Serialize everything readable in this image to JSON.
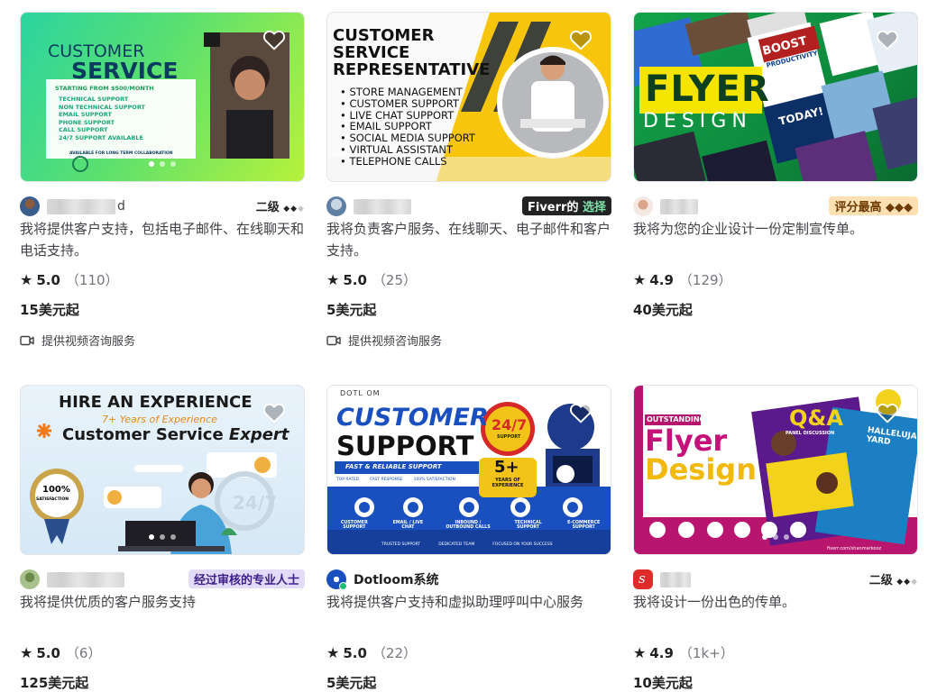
{
  "gigs": [
    {
      "thumb": {
        "title_line1": "CUSTOMER",
        "title_line2": "SERVICE",
        "starting": "STARTING FROM $500/MONTH",
        "items": [
          "TECHNICAL SUPPORT",
          "NON TECHNICAL SUPPORT",
          "EMAIL SUPPORT",
          "PHONE SUPPORT",
          "CALL SUPPORT",
          "24/7 SUPPORT AVAILABLE"
        ],
        "footer": "AVAILABLE FOR LONG TERM COLLABORATION"
      },
      "seller_name_tail": "d",
      "level": "二级",
      "title": "我将提供客户支持，包括电子邮件、在线聊天和电话支持。",
      "score": "5.0",
      "count": "（110）",
      "price": "15美元起",
      "video": "提供视频咨询服务"
    },
    {
      "thumb": {
        "title_line1": "CUSTOMER",
        "title_line2": "SERVICE",
        "title_line3": "REPRESENTATIVE",
        "items": [
          "STORE MANAGEMENT",
          "CUSTOMER SUPPORT",
          "LIVE CHAT SUPPORT",
          "EMAIL SUPPORT",
          "SOCIAL MEDIA SUPPORT",
          "VIRTUAL ASSISTANT",
          "TELEPHONE CALLS"
        ]
      },
      "badge_main": "Fiverr的",
      "badge_accent": "选择",
      "title": "我将负责客户服务、在线聊天、电子邮件和客户支持。",
      "score": "5.0",
      "count": "（25）",
      "price": "5美元起",
      "video": "提供视频咨询服务"
    },
    {
      "thumb": {
        "flyer": "FLYER",
        "design": "DESIGN",
        "boost": "BOOST",
        "productivity": "PRODUCTIVITY",
        "today": "TODAY!"
      },
      "badge": "评分最高 ◆◆◆",
      "title": "我将为您的企业设计一份定制宣传单。",
      "score": "4.9",
      "count": "（129）",
      "price": "40美元起"
    },
    {
      "thumb": {
        "line1": "HIRE AN EXPERIENCE",
        "line2": "7+ Years of Experience",
        "line3a": "Customer Service ",
        "line3b": "Expert",
        "seal_pct": "100%",
        "seal_text": "SATISFACTION",
        "clock": "24/7"
      },
      "badge": "经过审核的专业人士",
      "title": "我将提供优质的客户服务支持",
      "score": "5.0",
      "count": "（6）",
      "price": "125美元起"
    },
    {
      "thumb": {
        "logo": "DOTL  OM",
        "line1": "CUSTOMER",
        "line2": "SUPPORT",
        "strip": "FAST & RELIABLE SUPPORT",
        "badge247": "24/7",
        "badge247_sub": "SUPPORT",
        "years": "5+",
        "years_sub": "YEARS OF EXPERIENCE",
        "checks": [
          "TOP RATED",
          "FAST RESPONSE",
          "100% SATISFACTION"
        ],
        "services": [
          "CUSTOMER SUPPORT",
          "EMAIL / LIVE CHAT",
          "INBOUND / OUTBOUND CALLS",
          "TECHNICAL SUPPORT",
          "E-COMMERCE SUPPORT"
        ],
        "bottom": [
          "TRUSTED SUPPORT",
          "DEDICATED TEAM",
          "FOCUSED ON YOUR SUCCESS"
        ]
      },
      "seller_name": "Dotloom系统",
      "title": "我将提供客户支持和虚拟助理呼叫中心服务",
      "score": "5.0",
      "count": "（22）",
      "price": "5美元起"
    },
    {
      "thumb": {
        "outstanding": "OUTSTANDING",
        "flyer": "Flyer",
        "design": "Design",
        "qa": "Q&A",
        "qa_sub": "PANEL DISCUSSION",
        "hallelujah": "HALLELUJAH YARD",
        "url": "fiverr.com/shanmarkooz"
      },
      "level": "二级",
      "title": "我将设计一份出色的传单。",
      "score": "4.9",
      "count": "（1k+）",
      "price": "10美元起"
    }
  ],
  "colors": {
    "star": "#222222",
    "fiverr_green": "#1dbf73",
    "badge_choice_bg": "#222325",
    "badge_top_bg": "#ffe0b3",
    "badge_vetted_bg": "#e3dcf8"
  },
  "icons": {
    "favorite": "heart-icon",
    "rating": "star-icon",
    "video": "video-camera-icon"
  }
}
